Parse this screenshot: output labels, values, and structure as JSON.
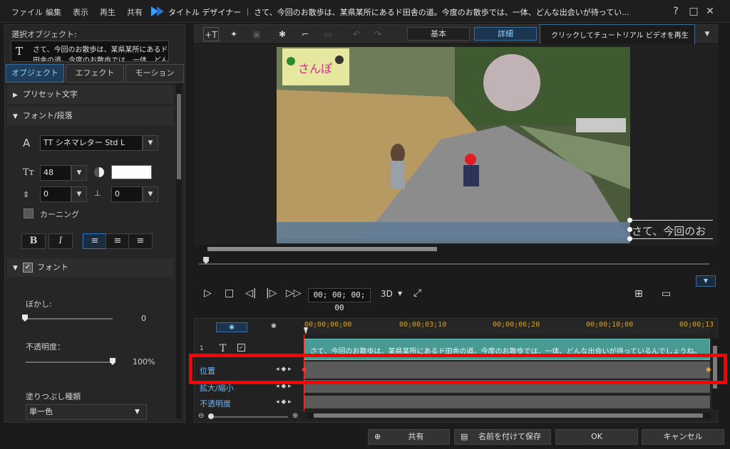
{
  "menu": [
    "ファイル",
    "編集",
    "表示",
    "再生",
    "共有"
  ],
  "window_title": "タイトル デザイナー ｜ さて、今回のお散歩は、某県某所にあるド田舎の道。今度のお散歩では、一体、どんな出会いが待ってい...",
  "window_buttons": [
    "?",
    "□",
    "✕"
  ],
  "left": {
    "selected_object_label": "選択オブジェクト:",
    "selected_object_text": "さて、今回のお散歩は、某県某所にあるド",
    "selected_object_text2": "田舎の道。今度のお散歩では、一体、どん",
    "tabs": [
      "オブジェクト",
      "エフェクト",
      "モーション"
    ],
    "preset_text": "プリセット文字",
    "font_paragraph": "フォント/段落",
    "font_name": "TT シネマレター Std L",
    "font_size": "48",
    "char_spacing": "0",
    "line_spacing": "0",
    "kerning": "カーニング",
    "bold": "B",
    "italic": "I",
    "font_section": "フォント",
    "blur_label": "ぼかし:",
    "blur_value": "0",
    "opacity_label": "不透明度：",
    "opacity_value": "100%",
    "fill_type_label": "塗りつぶし種類",
    "fill_type_value": "単一色",
    "colors": {
      "font_color": "#ffffff",
      "accent": "#6fb7ff"
    }
  },
  "toolbar": {
    "modes": [
      "基本",
      "詳細"
    ],
    "tooltip": "クリックしてチュートリアル ビデオを再生"
  },
  "preview": {
    "logo_text": "さんぽ",
    "caption_text": "さて、今回のお"
  },
  "transport": {
    "timecode": "00; 00; 00; 00",
    "mode3d": "3D"
  },
  "timeline": {
    "ruler": [
      "00;00;00;00",
      "00;00;03;10",
      "00;00;06;20",
      "00;00;10;00",
      "00;00;13"
    ],
    "clip_text": "さて、今回のお散歩は、某県某所にあるド田舎の道。今度のお散歩では、一体、どんな出会いが待っているんでしょうね。",
    "tracks": [
      "位置",
      "拡大/縮小",
      "不透明度"
    ],
    "track_num": "1"
  },
  "footer": {
    "share": "共有",
    "save_as": "名前を付けて保存",
    "ok": "OK",
    "cancel": "キャンセル"
  },
  "highlight_color": "#ff0000"
}
